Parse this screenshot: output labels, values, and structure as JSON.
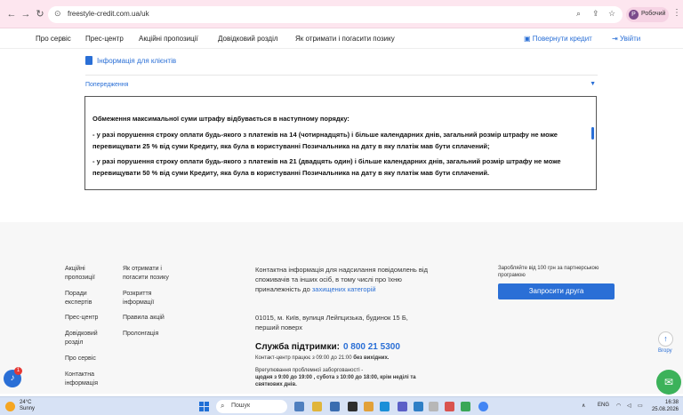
{
  "browser": {
    "url": "freestyle-credit.com.ua/uk",
    "profile_label": "Робочий",
    "profile_initial": "Р"
  },
  "header": {
    "nav": [
      "Про сервіс",
      "Прес-центр",
      "Акційні пропозиції",
      "Довідковий розділ",
      "Як отримати і погасити позику"
    ],
    "return_label": "Повернути кредит",
    "login_label": "Увійти"
  },
  "main": {
    "info_link": "Інформація для клієнтів",
    "accordion_title": "Попередження",
    "warning_paragraphs": [
      "Обмеження максимальної суми штрафу відбувається в наступному порядку:",
      "- у разі порушення строку оплати будь-якого з платежів на 14 (чотирнадцять) і більше календарних днів, загальний розмір штрафу не може перевищувати 25 % від суми Кредиту, яка була в користуванні Позичальника на дату в яку платіж мав бути сплачений;",
      "- у разі порушення строку оплати будь-якого з платежів на 21 (двадцять один) і більше календарних днів, загальний розмір штрафу не може перевищувати 50 % від суми Кредиту, яка була в користуванні Позичальника на дату в яку платіж мав бути сплачений."
    ]
  },
  "footer": {
    "col1": [
      "Акційні пропозиції",
      "Поради експертів",
      "Прес-центр",
      "Довідковий розділ",
      "Про сервіс",
      "Контактна інформація"
    ],
    "col2": [
      "Як отримати і погасити позику",
      "Розкриття інформації",
      "Правила акцій",
      "Пролонгація"
    ],
    "contact_text": "Контактна інформація для надсилання повідомлень від споживачів та інших осіб, в тому числі про їхню приналежність до",
    "contact_link": "захищених категорій",
    "address": "01015, м. Київ, вулиця Лейпцизька, будинок 15 Б, перший поверх",
    "support_label": "Служба підтримки:",
    "support_phone": "0 800 21 5300",
    "hours_text": "Контакт-центр працює з 09:00 до 21:00",
    "hours_bold": "без вихідних.",
    "graph_text": "Врегулювання проблемної заборгованості -",
    "graph_bold": "щодня з 9:00 до 19:00 , субота з 10:00 до 18:00, крім неділі та святкових днів.",
    "promo_text": "Заробляйте від 100 грн за партнерською програмою",
    "invite_button": "Запросити друга",
    "up_label": "Вгору",
    "bell_badge": "1"
  },
  "taskbar": {
    "temp": "24°C",
    "weather": "Sunny",
    "search_label": "Пошук",
    "lang": "ENG",
    "time": "16:38",
    "date": "25.08.2026"
  }
}
